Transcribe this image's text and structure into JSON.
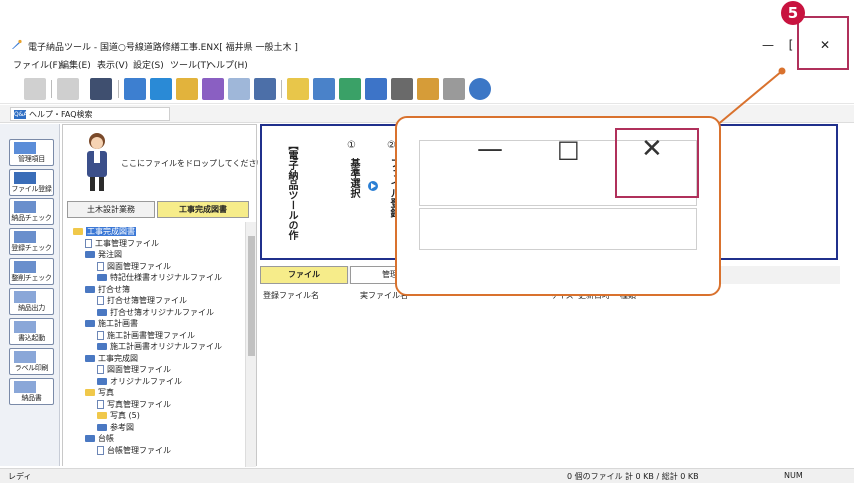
{
  "window": {
    "title": "電子納品ツール - 国道○号線道路修繕工事.ENX[ 福井県 一般土木 ]",
    "minimize_glyph": "—",
    "restore_glyph": "[",
    "close_glyph": "✕"
  },
  "menu": [
    "ファイル(F)",
    "編集(E)",
    "表示(V)",
    "設定(S)",
    "ツール(T)",
    "ヘルプ(H)"
  ],
  "help": {
    "label": "ヘルプ・FAQ検索",
    "icon": "Q&A"
  },
  "left_buttons": [
    "管理項目",
    "ファイル登録",
    "納品チェック",
    "登録チェック",
    "整削チェック",
    "納品出力",
    "書込起動",
    "ラベル印刷",
    "納品書"
  ],
  "drop_area": {
    "text": "ここにファイルをドロップしてください"
  },
  "tabs": [
    "土木設計業務",
    "工事完成図書"
  ],
  "tree": [
    {
      "label": "工事完成図書",
      "level": 0,
      "kind": "folder-open"
    },
    {
      "label": "工事管理ファイル",
      "level": 1,
      "kind": "file"
    },
    {
      "label": "発注図",
      "level": 1,
      "kind": "folder"
    },
    {
      "label": "図面管理ファイル",
      "level": 2,
      "kind": "file"
    },
    {
      "label": "特記仕様書オリジナルファイル",
      "level": 2,
      "kind": "folder"
    },
    {
      "label": "打合せ簿",
      "level": 1,
      "kind": "folder"
    },
    {
      "label": "打合せ簿管理ファイル",
      "level": 2,
      "kind": "file"
    },
    {
      "label": "打合せ簿オリジナルファイル",
      "level": 2,
      "kind": "folder"
    },
    {
      "label": "施工計画書",
      "level": 1,
      "kind": "folder"
    },
    {
      "label": "施工計画書管理ファイル",
      "level": 2,
      "kind": "file"
    },
    {
      "label": "施工計画書オリジナルファイル",
      "level": 2,
      "kind": "folder"
    },
    {
      "label": "工事完成図",
      "level": 1,
      "kind": "folder"
    },
    {
      "label": "図面管理ファイル",
      "level": 2,
      "kind": "file"
    },
    {
      "label": "オリジナルファイル",
      "level": 2,
      "kind": "folder"
    },
    {
      "label": "写真",
      "level": 1,
      "kind": "folder-yellow"
    },
    {
      "label": "写真管理ファイル",
      "level": 2,
      "kind": "file"
    },
    {
      "label": "写真 (5)",
      "level": 2,
      "kind": "folder-yellow"
    },
    {
      "label": "参考図",
      "level": 2,
      "kind": "folder"
    },
    {
      "label": "台帳",
      "level": 1,
      "kind": "folder"
    },
    {
      "label": "台帳管理ファイル",
      "level": 2,
      "kind": "file"
    }
  ],
  "flow": {
    "heading": "【電子納品ツールの作",
    "step1_num": "①",
    "step1": "基準選択",
    "step2_num": "②",
    "step2": "ファイル登録"
  },
  "file_tabs": [
    "ファイル",
    "管理"
  ],
  "columns": [
    "登録ファイル名",
    "実ファイル名",
    "サイズ",
    "更新日時",
    "種類"
  ],
  "status": {
    "left": "レディ",
    "count": "0 個のファイル",
    "sizes": "計 0 KB / 総計 0 KB",
    "mode": "NUM"
  },
  "callout": {
    "minimize": "—",
    "maximize": "□",
    "close": "✕"
  },
  "step_badge": "5",
  "colors": {
    "accent": "#d9722e",
    "highlight": "#b0305b",
    "badge": "#c8133f",
    "flow_border": "#20308c"
  }
}
